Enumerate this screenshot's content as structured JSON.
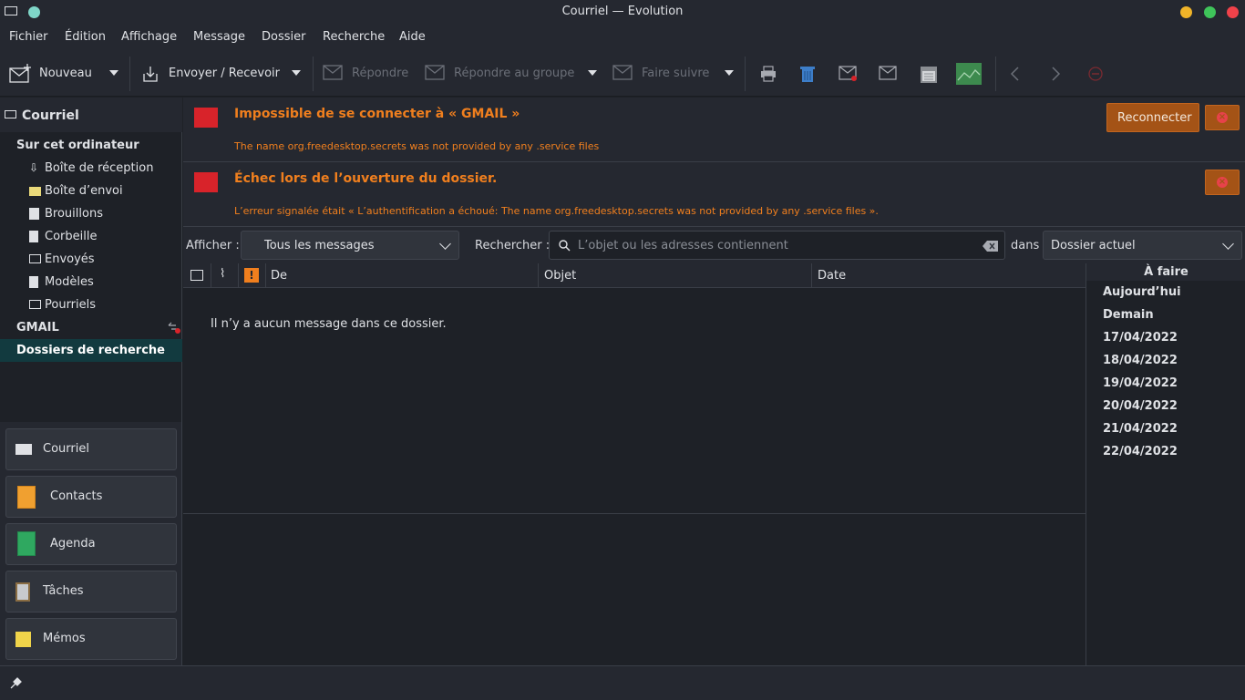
{
  "window": {
    "title": "Courriel — Evolution"
  },
  "menu": [
    "Fichier",
    "Édition",
    "Affichage",
    "Message",
    "Dossier",
    "Recherche",
    "Aide"
  ],
  "toolbar": {
    "new": "Nouveau",
    "send_receive": "Envoyer / Recevoir",
    "reply": "Répondre",
    "reply_group": "Répondre au groupe",
    "forward": "Faire suivre"
  },
  "sidebar": {
    "header": "Courriel",
    "local_group": "Sur cet ordinateur",
    "folders": [
      "Boîte de réception",
      "Boîte d’envoi",
      "Brouillons",
      "Corbeille",
      "Envoyés",
      "Modèles",
      "Pourriels"
    ],
    "gmail": "GMAIL",
    "search_folders": "Dossiers de recherche"
  },
  "switcher": [
    "Courriel",
    "Contacts",
    "Agenda",
    "Tâches",
    "Mémos"
  ],
  "alerts": [
    {
      "title": "Impossible de se connecter à « GMAIL »",
      "detail": "The name org.freedesktop.secrets was not provided by any .service files",
      "button": "Reconnecter"
    },
    {
      "title": "Échec lors de l’ouverture du dossier.",
      "detail": "L’erreur signalée était « L’authentification a échoué: The name org.freedesktop.secrets was not provided by any .service files »."
    }
  ],
  "filter": {
    "show_label": "Afficher :",
    "show_value": "Tous les messages",
    "search_label": "Rechercher :",
    "search_placeholder": "L’objet ou les adresses contiennent",
    "in_label": "dans",
    "scope_value": "Dossier actuel"
  },
  "columns": [
    "De",
    "Objet",
    "Date"
  ],
  "empty_message": "Il n’y a aucun message dans ce dossier.",
  "todo": {
    "title": "À faire",
    "days": [
      "Aujourd’hui",
      "Demain",
      "17/04/2022",
      "18/04/2022",
      "19/04/2022",
      "20/04/2022",
      "21/04/2022",
      "22/04/2022"
    ]
  },
  "colors": {
    "accent": "#f07f1e",
    "selected": "#123a3f",
    "error": "#d8232a"
  }
}
